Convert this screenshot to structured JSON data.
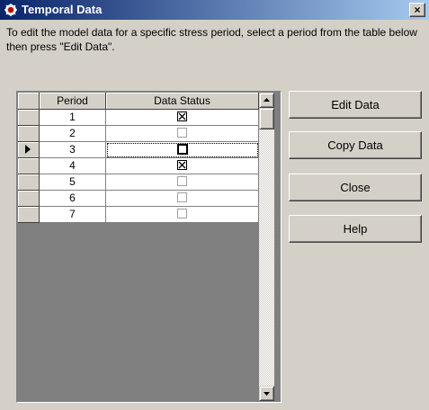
{
  "window": {
    "title": "Temporal Data",
    "close_label": "×"
  },
  "instruction": "To edit the model data for a specific stress period, select a period from the table below then press \"Edit Data\".",
  "table": {
    "columns": [
      "Period",
      "Data Status"
    ],
    "rows": [
      {
        "period": "1",
        "status": "checked"
      },
      {
        "period": "2",
        "status": "unchecked"
      },
      {
        "period": "3",
        "status": "unchecked",
        "current": true
      },
      {
        "period": "4",
        "status": "checked"
      },
      {
        "period": "5",
        "status": "unchecked"
      },
      {
        "period": "6",
        "status": "unchecked"
      },
      {
        "period": "7",
        "status": "unchecked"
      }
    ]
  },
  "buttons": {
    "edit": "Edit Data",
    "copy": "Copy Data",
    "close": "Close",
    "help": "Help"
  }
}
